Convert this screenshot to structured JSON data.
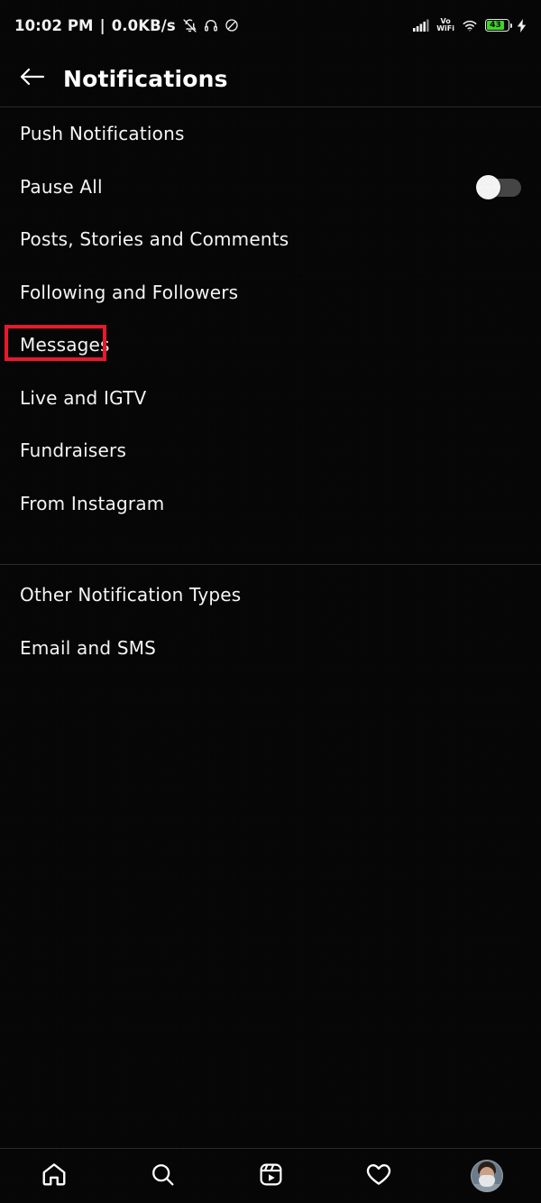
{
  "status_bar": {
    "clock": "10:02 PM",
    "separator": "|",
    "network_speed": "0.0KB/s",
    "icons_left": [
      "bell-muted-icon",
      "headphones-icon",
      "dnd-icon"
    ],
    "signal_label": "signal-bars-icon",
    "volte_line1": "Vo",
    "volte_line2": "WiFi",
    "wifi_label": "wifi-icon",
    "battery_percent": "43",
    "battery_fill_color": "#3fd42a",
    "charging_label": "charging-bolt-icon"
  },
  "header": {
    "back_label": "back-arrow-icon",
    "title": "Notifications"
  },
  "sections": [
    {
      "name": "push",
      "items": [
        {
          "label": "Push Notifications",
          "type": "header-row",
          "toggle": null
        },
        {
          "label": "Pause All",
          "type": "toggle-row",
          "toggle": {
            "state": "off",
            "track_color": "#454545",
            "knob_color": "#f3f3f3"
          }
        },
        {
          "label": "Posts, Stories and Comments",
          "type": "nav-row",
          "toggle": null
        },
        {
          "label": "Following and Followers",
          "type": "nav-row",
          "toggle": null
        },
        {
          "label": "Messages",
          "type": "nav-row",
          "toggle": null,
          "highlighted": true,
          "highlight_color": "#e8192c"
        },
        {
          "label": "Live and IGTV",
          "type": "nav-row",
          "toggle": null
        },
        {
          "label": "Fundraisers",
          "type": "nav-row",
          "toggle": null
        },
        {
          "label": "From Instagram",
          "type": "nav-row",
          "toggle": null
        }
      ]
    },
    {
      "name": "other",
      "items": [
        {
          "label": "Other Notification Types",
          "type": "header-row",
          "toggle": null
        },
        {
          "label": "Email and SMS",
          "type": "nav-row",
          "toggle": null
        }
      ]
    }
  ],
  "bottom_nav": [
    {
      "name": "home",
      "icon": "home-icon",
      "active": false
    },
    {
      "name": "search",
      "icon": "search-icon",
      "active": false
    },
    {
      "name": "reels",
      "icon": "reels-icon",
      "active": false
    },
    {
      "name": "activity",
      "icon": "heart-icon",
      "active": false
    },
    {
      "name": "profile",
      "icon": "profile-avatar",
      "active": false
    }
  ],
  "theme": {
    "background": "#060606",
    "text": "#f5f5f5",
    "divider": "#2a2a2a",
    "highlight": "#e8192c"
  }
}
